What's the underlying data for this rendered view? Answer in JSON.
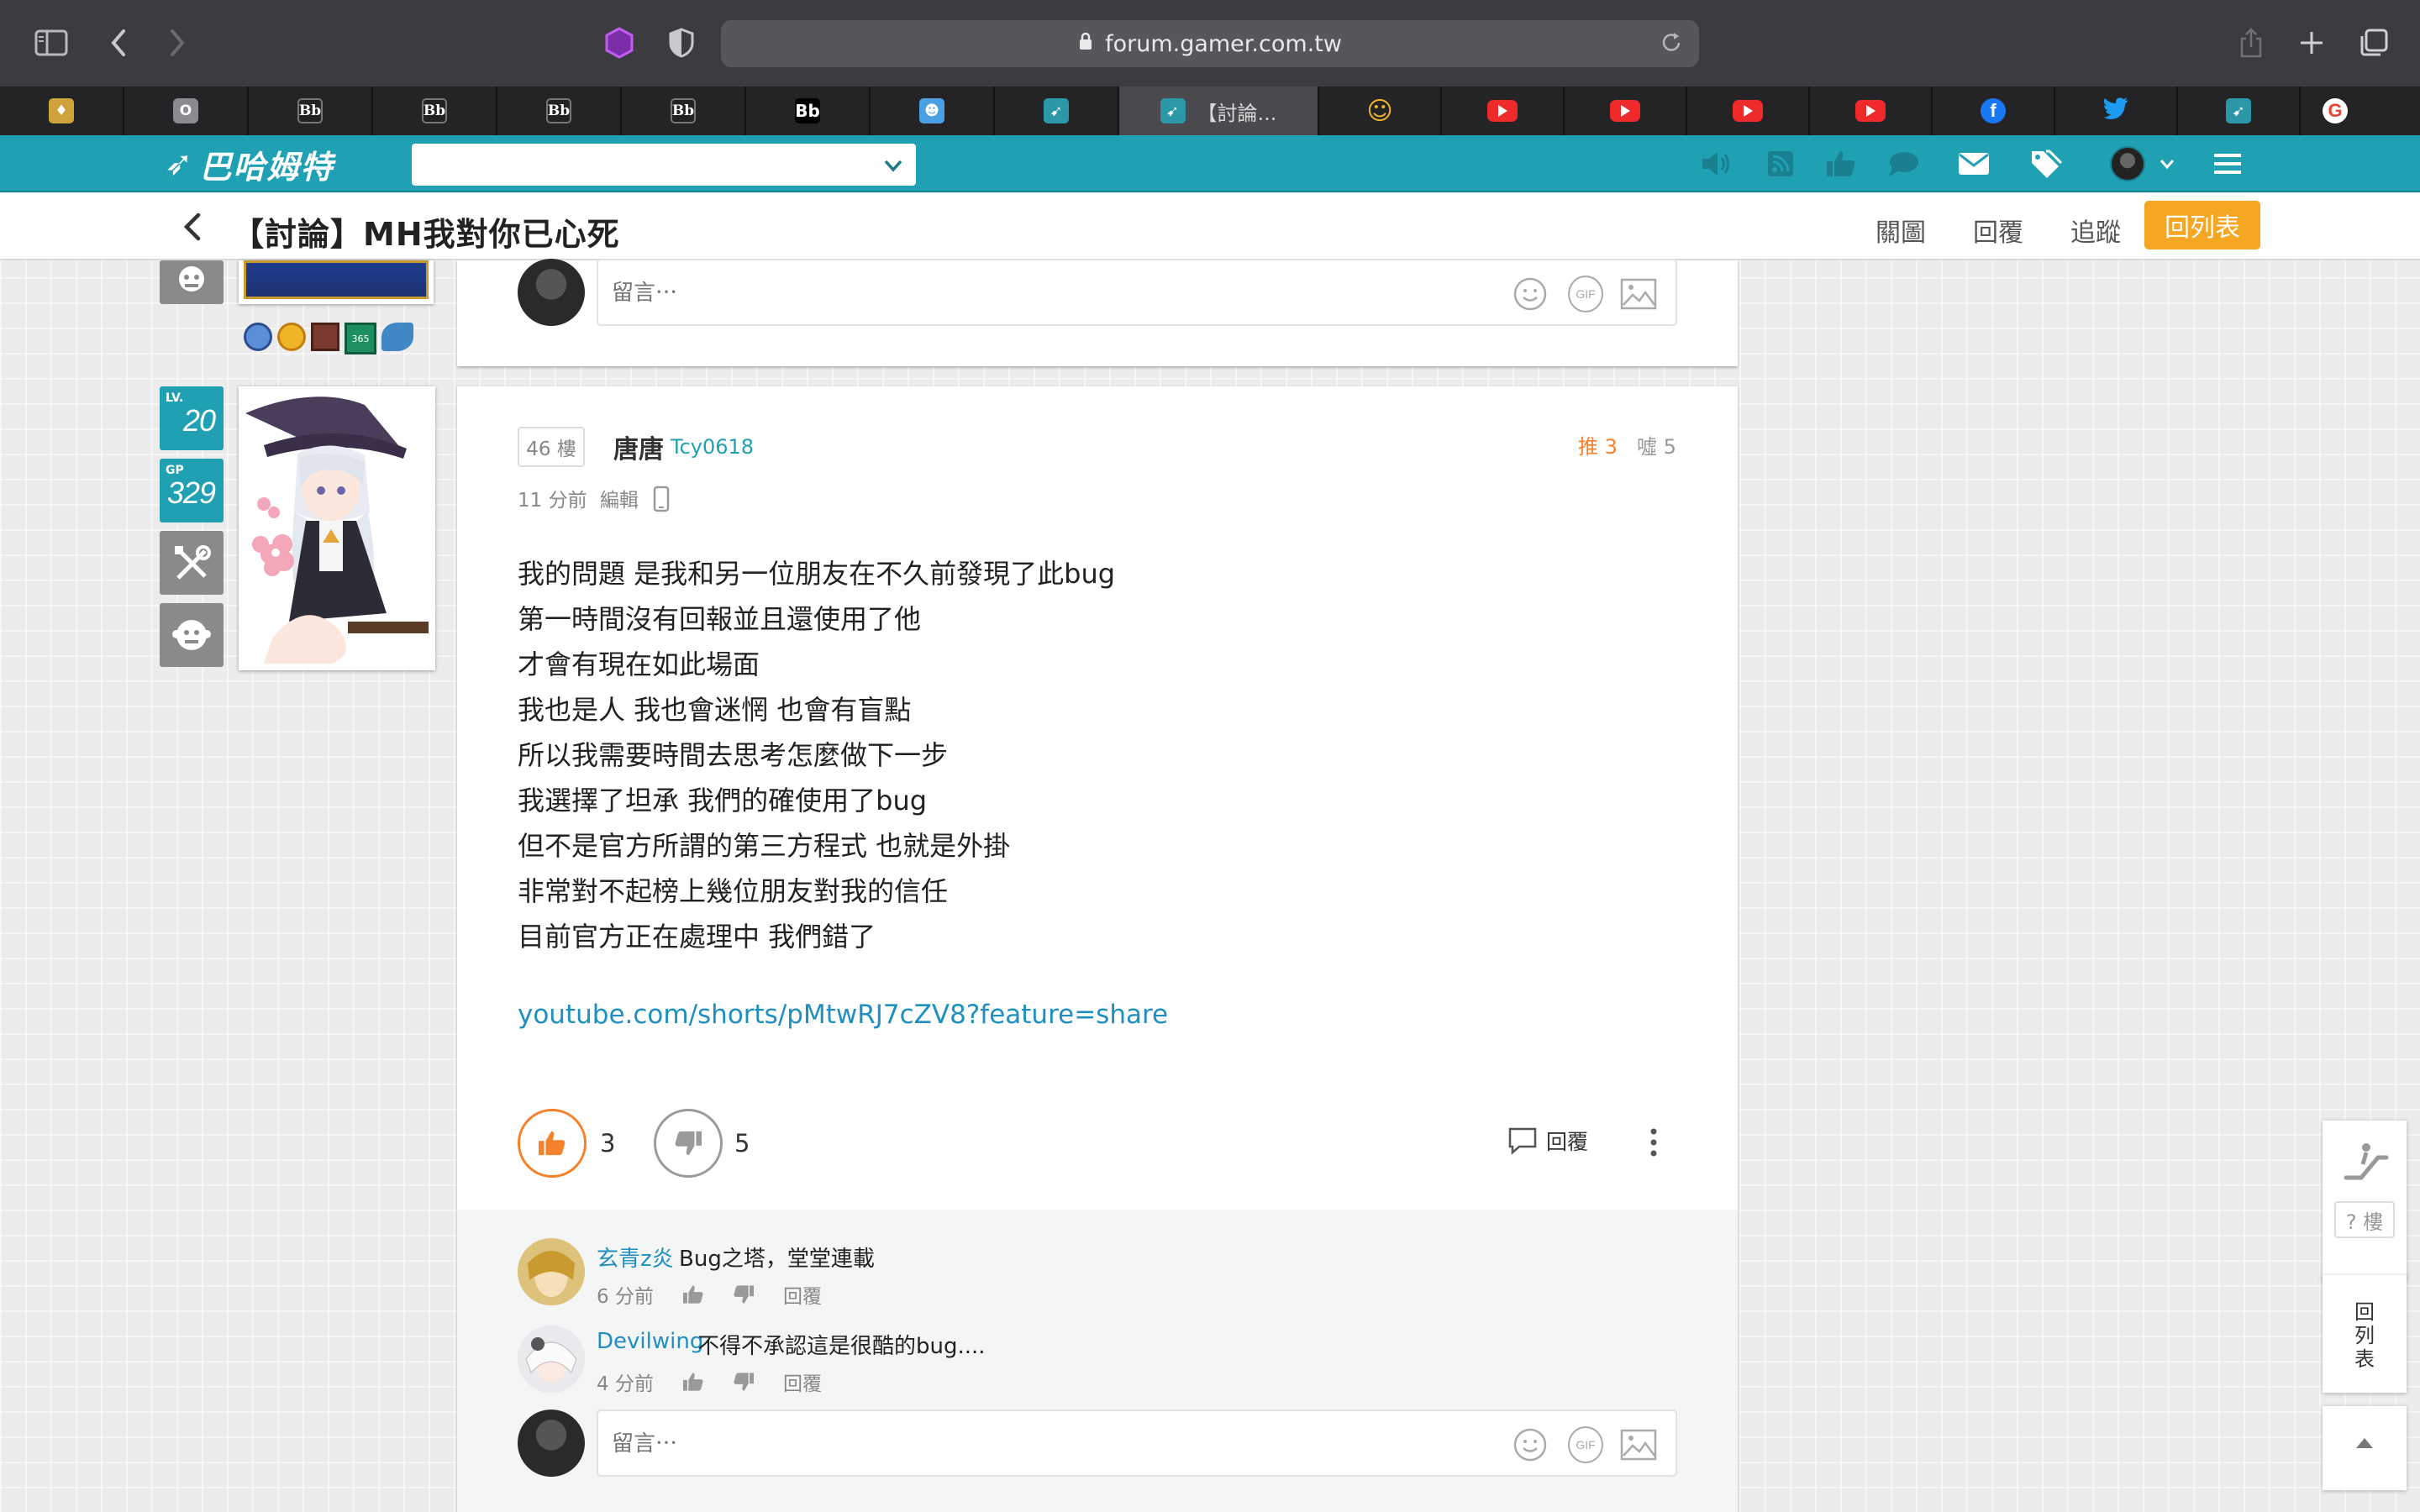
{
  "browser": {
    "url": "forum.gamer.com.tw",
    "tabs": [
      {
        "icon": "gold-shield-icon",
        "label": ""
      },
      {
        "icon": "o-icon",
        "label": "O"
      },
      {
        "icon": "bb-icon",
        "label": "Bb"
      },
      {
        "icon": "bb-icon",
        "label": "Bb"
      },
      {
        "icon": "bb-icon",
        "label": "Bb"
      },
      {
        "icon": "bb-icon",
        "label": "Bb"
      },
      {
        "icon": "bb-dark-icon",
        "label": "Bb"
      },
      {
        "icon": "user-card-icon",
        "label": ""
      },
      {
        "icon": "gamer-icon",
        "label": ""
      },
      {
        "icon": "gamer-icon",
        "label": "【討論..."
      },
      {
        "icon": "smiley-icon",
        "label": "☺"
      },
      {
        "icon": "youtube-icon",
        "label": ""
      },
      {
        "icon": "youtube-icon",
        "label": ""
      },
      {
        "icon": "youtube-icon",
        "label": ""
      },
      {
        "icon": "youtube-icon",
        "label": ""
      },
      {
        "icon": "facebook-icon",
        "label": "f"
      },
      {
        "icon": "twitter-icon",
        "label": ""
      },
      {
        "icon": "gamer-icon",
        "label": ""
      },
      {
        "icon": "google-icon",
        "label": "G"
      }
    ]
  },
  "site": {
    "logo_text": "巴哈姆特",
    "search_value": "",
    "brand_color": "#1fa1b3",
    "accent_color": "#f5a623"
  },
  "subheader": {
    "title": "【討論】MH我對你已心死",
    "links": [
      "關圖",
      "回覆",
      "追蹤"
    ],
    "list_button": "回列表"
  },
  "user_panel": {
    "level_tag": "LV.",
    "level": "20",
    "gp_tag": "GP",
    "gp": "329"
  },
  "prev_post": {
    "comment_placeholder": "留言⋯",
    "gif_label": "GIF"
  },
  "post": {
    "floor": "46 樓",
    "author_name": "唐唐",
    "author_id": "Tcy0618",
    "time": "11 分前",
    "edit": "編輯",
    "push_label": "推 3",
    "boo_label": "噓 5",
    "content": [
      "我的問題 是我和另一位朋友在不久前發現了此bug",
      "第一時間沒有回報並且還使用了他",
      "才會有現在如此場面",
      "我也是人 我也會迷惘 也會有盲點",
      "所以我需要時間去思考怎麼做下一步",
      "我選擇了坦承 我們的確使用了bug",
      "但不是官方所謂的第三方程式 也就是外掛",
      "非常對不起榜上幾位朋友對我的信任",
      "目前官方正在處理中 我們錯了"
    ],
    "link": "youtube.com/shorts/pMtwRJ7cZV8?feature=share",
    "gp_count": "3",
    "bp_count": "5",
    "reply_label": "回覆",
    "comments": [
      {
        "name": "玄青z炎",
        "text": "Bug之塔，堂堂連載",
        "time": "6 分前",
        "reply": "回覆"
      },
      {
        "name": "Devilwing",
        "text": "不得不承認這是很酷的bug....",
        "time": "4 分前",
        "reply": "回覆"
      }
    ],
    "comment_placeholder": "留言⋯",
    "gif_label": "GIF"
  },
  "floating": {
    "floor_jump": "? 樓",
    "back_to_list": "回列表"
  }
}
